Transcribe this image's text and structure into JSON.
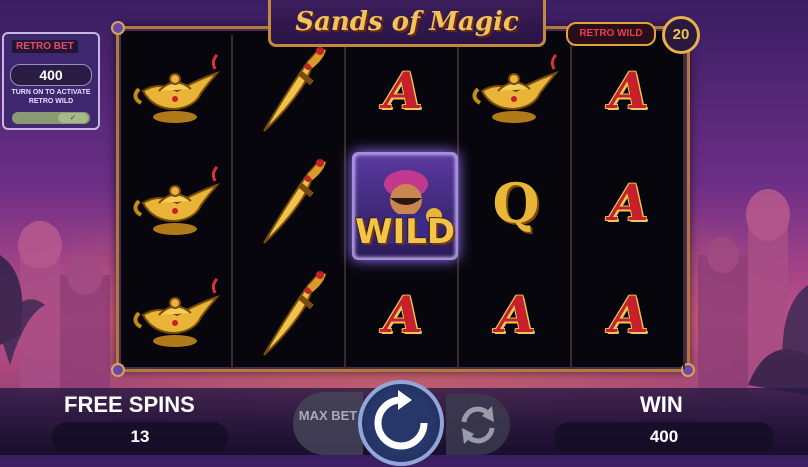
{
  "game": {
    "title": "Sands of Magic"
  },
  "retro_bet": {
    "logo": "RETRO BET",
    "value": "400",
    "caption": "TURN ON TO ACTIVATE RETRO WILD",
    "toggle_state": "on"
  },
  "retro_wild": {
    "label": "RETRO WILD",
    "count": "20"
  },
  "reels": [
    [
      "lamp",
      "lamp",
      "lamp"
    ],
    [
      "dagger",
      "dagger",
      "dagger"
    ],
    [
      "A",
      "WILD",
      "A"
    ],
    [
      "lamp",
      "Q",
      "A"
    ],
    [
      "A",
      "A",
      "A"
    ]
  ],
  "wild_label": "WILD",
  "free_spins": {
    "label": "FREE SPINS",
    "value": "13"
  },
  "win": {
    "label": "WIN",
    "value": "400"
  },
  "controls": {
    "max_bet_label": "MAX BET",
    "spin_icon": "spin-icon",
    "autoplay_icon": "autoplay-icon"
  },
  "colors": {
    "accent_gold": "#e7b049",
    "letter_red": "#c8202a",
    "wild_purple": "#9b78ff"
  }
}
